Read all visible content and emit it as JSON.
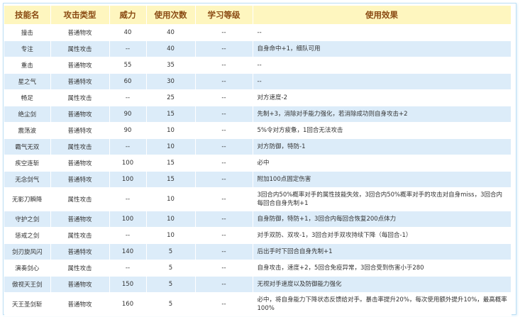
{
  "headers": [
    "技能名",
    "攻击类型",
    "威力",
    "使用次数",
    "学习等级",
    "使用效果"
  ],
  "rows": [
    [
      "撞击",
      "普通物攻",
      "40",
      "40",
      "--",
      "--"
    ],
    [
      "专注",
      "属性攻击",
      "--",
      "40",
      "--",
      "自身命中+1，细队可用"
    ],
    [
      "重击",
      "普通物攻",
      "55",
      "35",
      "--",
      "--"
    ],
    [
      "星之气",
      "普通特攻",
      "60",
      "30",
      "--",
      "--"
    ],
    [
      "畅足",
      "属性攻击",
      "--",
      "25",
      "--",
      "对方速度-2"
    ],
    [
      "绝尘剑",
      "普通物攻",
      "90",
      "15",
      "--",
      "先制+3，消除对手能力强化，若消除成功则自身攻击+2"
    ],
    [
      "震荡波",
      "普通特攻",
      "90",
      "10",
      "--",
      "5%令对方疲惫，1回合无法攻击"
    ],
    [
      "霸气无双",
      "属性攻击",
      "--",
      "10",
      "--",
      "对方防御，特防-1"
    ],
    [
      "疾空连斩",
      "普通物攻",
      "100",
      "15",
      "--",
      "必中"
    ],
    [
      "无念剑气",
      "普通特攻",
      "100",
      "15",
      "--",
      "附加100点固定伤害"
    ],
    [
      "无影刀瞬降",
      "属性攻击",
      "--",
      "10",
      "--",
      "3回合内50%概率对手的属性技能失效，3回合内50%概率对手的攻击对自身miss，3回合内每回合自身先制+1"
    ],
    [
      "守护之剑",
      "普通物攻",
      "100",
      "10",
      "--",
      "自身防御，特防+1，3回合内每回合恢复200点体力"
    ],
    [
      "惩戒之剑",
      "属性攻击",
      "--",
      "10",
      "--",
      "对手双防、双攻-1，3回合对手双攻持续下降（每回合-1）"
    ],
    [
      "剑刃旋风闪",
      "普通特攻",
      "140",
      "5",
      "--",
      "后出手时下回合自身先制+1"
    ],
    [
      "演奏剑心",
      "属性攻击",
      "--",
      "5",
      "--",
      "自身攻击，速度+2，5回合免疫异常，3回合受到伤害小于280"
    ],
    [
      "傲视天王剑",
      "普通物攻",
      "150",
      "5",
      "--",
      "无视对手速度以及防御能力强化"
    ],
    [
      "天王圣剑斩",
      "普通物攻",
      "160",
      "5",
      "--",
      "必中，将自身能力下降状态反馈给对手。暴击率提升20%，每次使用额外提升10%，最高概率100%"
    ]
  ]
}
